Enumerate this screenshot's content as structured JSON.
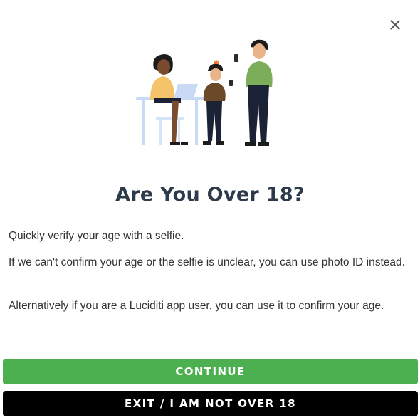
{
  "modal": {
    "title": "Are You Over 18?",
    "paragraphs": [
      "Quickly verify your age with a selfie.",
      "If we can't confirm your age or the selfie is unclear, you can use photo ID instead.",
      "Alternatively if you are a Luciditi app user, you can use it to confirm your age."
    ],
    "close_icon": "close-icon",
    "illustration_icon": "people-using-devices-illustration"
  },
  "buttons": {
    "continue_label": "CONTINUE",
    "exit_label": "EXIT / I AM NOT OVER 18"
  },
  "colors": {
    "continue_bg": "#4caf50",
    "exit_bg": "#000000",
    "title_color": "#2d3a4a"
  }
}
